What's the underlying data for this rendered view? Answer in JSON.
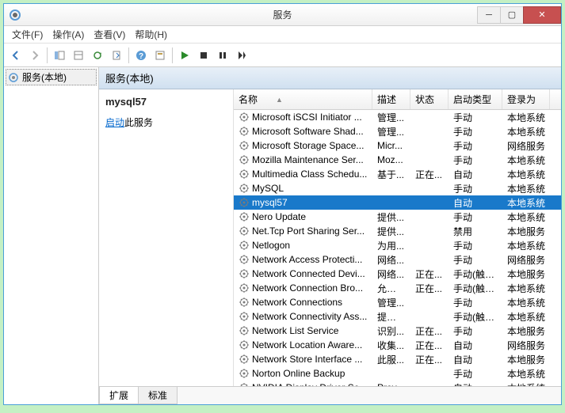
{
  "window": {
    "title": "服务"
  },
  "menu": {
    "file": "文件(F)",
    "action": "操作(A)",
    "view": "查看(V)",
    "help": "帮助(H)"
  },
  "tree": {
    "root": "服务(本地)"
  },
  "panel": {
    "header": "服务(本地)"
  },
  "action_pane": {
    "selected_name": "mysql57",
    "start_link": "启动",
    "start_suffix": "此服务"
  },
  "columns": {
    "name": "名称",
    "description": "描述",
    "status": "状态",
    "startup": "启动类型",
    "logon": "登录为"
  },
  "tabs": {
    "extended": "扩展",
    "standard": "标准"
  },
  "services": [
    {
      "name": "Microsoft iSCSI Initiator ...",
      "desc": "管理...",
      "status": "",
      "startup": "手动",
      "logon": "本地系统",
      "selected": false
    },
    {
      "name": "Microsoft Software Shad...",
      "desc": "管理...",
      "status": "",
      "startup": "手动",
      "logon": "本地系统",
      "selected": false
    },
    {
      "name": "Microsoft Storage Space...",
      "desc": "Micr...",
      "status": "",
      "startup": "手动",
      "logon": "网络服务",
      "selected": false
    },
    {
      "name": "Mozilla Maintenance Ser...",
      "desc": "Moz...",
      "status": "",
      "startup": "手动",
      "logon": "本地系统",
      "selected": false
    },
    {
      "name": "Multimedia Class Schedu...",
      "desc": "基于...",
      "status": "正在...",
      "startup": "自动",
      "logon": "本地系统",
      "selected": false
    },
    {
      "name": "MySQL",
      "desc": "",
      "status": "",
      "startup": "手动",
      "logon": "本地系统",
      "selected": false
    },
    {
      "name": "mysql57",
      "desc": "",
      "status": "",
      "startup": "自动",
      "logon": "本地系统",
      "selected": true
    },
    {
      "name": "Nero Update",
      "desc": "提供...",
      "status": "",
      "startup": "手动",
      "logon": "本地系统",
      "selected": false
    },
    {
      "name": "Net.Tcp Port Sharing Ser...",
      "desc": "提供...",
      "status": "",
      "startup": "禁用",
      "logon": "本地服务",
      "selected": false
    },
    {
      "name": "Netlogon",
      "desc": "为用...",
      "status": "",
      "startup": "手动",
      "logon": "本地系统",
      "selected": false
    },
    {
      "name": "Network Access Protecti...",
      "desc": "网络...",
      "status": "",
      "startup": "手动",
      "logon": "网络服务",
      "selected": false
    },
    {
      "name": "Network Connected Devi...",
      "desc": "网络...",
      "status": "正在...",
      "startup": "手动(触发...",
      "logon": "本地服务",
      "selected": false
    },
    {
      "name": "Network Connection Bro...",
      "desc": "允许 ...",
      "status": "正在...",
      "startup": "手动(触发...",
      "logon": "本地系统",
      "selected": false
    },
    {
      "name": "Network Connections",
      "desc": "管理...",
      "status": "",
      "startup": "手动",
      "logon": "本地系统",
      "selected": false
    },
    {
      "name": "Network Connectivity Ass...",
      "desc": "提供 ...",
      "status": "",
      "startup": "手动(触发...",
      "logon": "本地系统",
      "selected": false
    },
    {
      "name": "Network List Service",
      "desc": "识别...",
      "status": "正在...",
      "startup": "手动",
      "logon": "本地服务",
      "selected": false
    },
    {
      "name": "Network Location Aware...",
      "desc": "收集...",
      "status": "正在...",
      "startup": "自动",
      "logon": "网络服务",
      "selected": false
    },
    {
      "name": "Network Store Interface ...",
      "desc": "此服...",
      "status": "正在...",
      "startup": "自动",
      "logon": "本地服务",
      "selected": false
    },
    {
      "name": "Norton Online Backup",
      "desc": "",
      "status": "",
      "startup": "手动",
      "logon": "本地系统",
      "selected": false
    },
    {
      "name": "NVIDIA Display Driver Se...",
      "desc": "Prov...",
      "status": "",
      "startup": "自动",
      "logon": "本地系统",
      "selected": false
    }
  ]
}
